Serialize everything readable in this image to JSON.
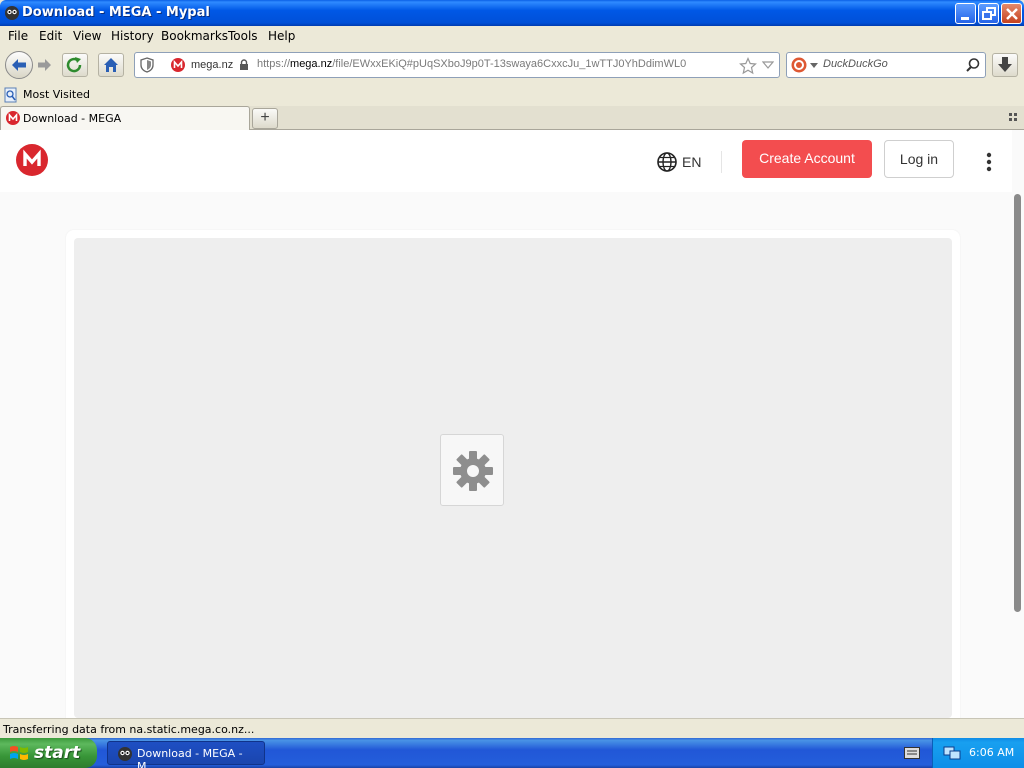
{
  "window": {
    "title": "Download - MEGA - Mypal"
  },
  "menu": [
    "File",
    "Edit",
    "View",
    "History",
    "Bookmarks",
    "Tools",
    "Help"
  ],
  "navbar": {
    "site_identity": "mega.nz",
    "url_prefix": "https://",
    "url_domain": "mega.nz",
    "url_path": "/file/EWxxEKiQ#pUqSXboJ9p0T-13swaya6CxxcJu_1wTTJ0YhDdimWL0",
    "search_placeholder": "DuckDuckGo"
  },
  "bookmarks": {
    "most_visited": "Most Visited"
  },
  "tabs": [
    {
      "label": "Download - MEGA"
    }
  ],
  "page": {
    "language": "EN",
    "create_account": "Create Account",
    "login": "Log in"
  },
  "status": {
    "text": "Transferring data from na.static.mega.co.nz..."
  },
  "taskbar": {
    "start": "start",
    "task_label": "Download - MEGA - M...",
    "clock": "6:06 AM"
  },
  "colors": {
    "mega_red": "#D9272E",
    "create_button": "#F34D4F",
    "xp_blue": "#245EDB",
    "xp_green": "#389638"
  },
  "icons": [
    "back-icon",
    "forward-icon",
    "reload-icon",
    "home-icon",
    "shield-icon",
    "lock-icon",
    "star-icon",
    "dropdown-icon",
    "search-icon",
    "download-icon",
    "globe-icon",
    "kebab-icon",
    "gear-icon",
    "windows-flag-icon"
  ]
}
